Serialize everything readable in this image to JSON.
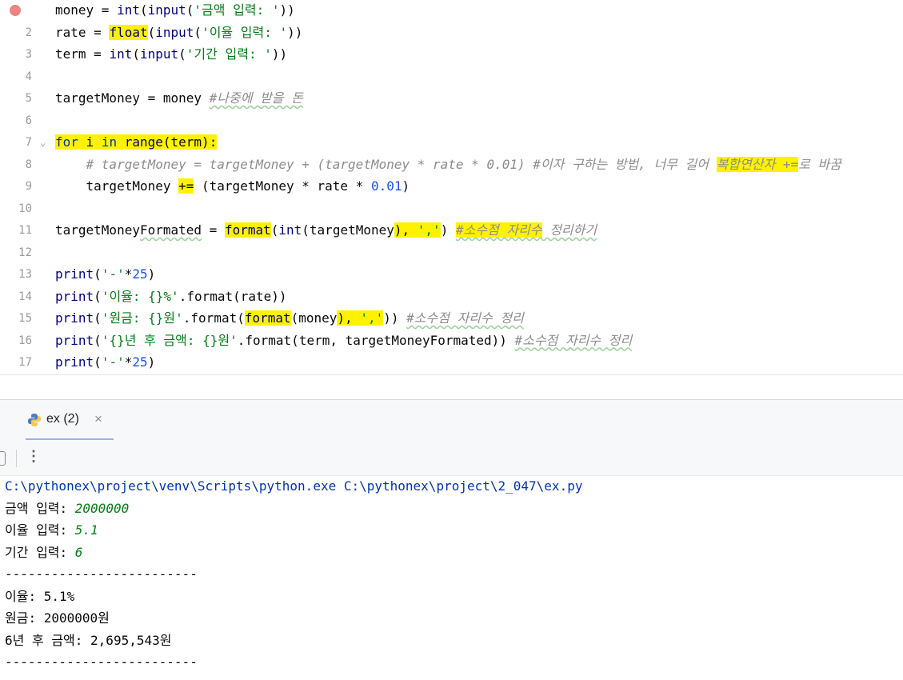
{
  "editor": {
    "lines": [
      {
        "n": "1",
        "tokens": [
          {
            "t": "money = ",
            "c": "plain"
          },
          {
            "t": "int",
            "c": "bi"
          },
          {
            "t": "(",
            "c": "plain"
          },
          {
            "t": "input",
            "c": "bi"
          },
          {
            "t": "(",
            "c": "plain"
          },
          {
            "t": "'금액 입력: '",
            "c": "str"
          },
          {
            "t": "))",
            "c": "plain"
          }
        ]
      },
      {
        "n": "2",
        "tokens": [
          {
            "t": "rate = ",
            "c": "plain"
          },
          {
            "t": "float",
            "c": "bi",
            "h": 1
          },
          {
            "t": "(",
            "c": "plain"
          },
          {
            "t": "input",
            "c": "bi"
          },
          {
            "t": "(",
            "c": "plain"
          },
          {
            "t": "'이율 입력: '",
            "c": "str"
          },
          {
            "t": "))",
            "c": "plain"
          }
        ]
      },
      {
        "n": "3",
        "tokens": [
          {
            "t": "term = ",
            "c": "plain"
          },
          {
            "t": "int",
            "c": "bi"
          },
          {
            "t": "(",
            "c": "plain"
          },
          {
            "t": "input",
            "c": "bi"
          },
          {
            "t": "(",
            "c": "plain"
          },
          {
            "t": "'기간 입력: '",
            "c": "str"
          },
          {
            "t": "))",
            "c": "plain"
          }
        ]
      },
      {
        "n": "4",
        "tokens": []
      },
      {
        "n": "5",
        "tokens": [
          {
            "t": "targetMoney = money ",
            "c": "plain"
          },
          {
            "t": "#나중에 받을 돈",
            "c": "cm-wavy"
          }
        ]
      },
      {
        "n": "6",
        "tokens": []
      },
      {
        "n": "7",
        "tokens": [
          {
            "t": "for",
            "c": "kw",
            "h": 1
          },
          {
            "t": " i ",
            "c": "plain",
            "h": 1
          },
          {
            "t": "in",
            "c": "kw",
            "h": 1
          },
          {
            "t": " ",
            "c": "plain",
            "h": 1
          },
          {
            "t": "range",
            "c": "bi",
            "h": 1
          },
          {
            "t": "(term):",
            "c": "plain",
            "h": 1
          }
        ]
      },
      {
        "n": "8",
        "tokens": [
          {
            "t": "    ",
            "c": "plain"
          },
          {
            "t": "# targetMoney = targetMoney + (targetMoney * rate * 0.01) #이자 구하는 방법, 너무 길어 ",
            "c": "cm"
          },
          {
            "t": "복합연산자 +=",
            "c": "cm",
            "h": 1
          },
          {
            "t": "로 바꿈",
            "c": "cm"
          }
        ]
      },
      {
        "n": "9",
        "tokens": [
          {
            "t": "    targetMoney ",
            "c": "plain"
          },
          {
            "t": "+=",
            "c": "plain",
            "h": 1
          },
          {
            "t": " (targetMoney * rate * ",
            "c": "plain"
          },
          {
            "t": "0.01",
            "c": "num"
          },
          {
            "t": ")",
            "c": "plain"
          }
        ]
      },
      {
        "n": "10",
        "tokens": []
      },
      {
        "n": "11",
        "tokens": [
          {
            "t": "targetMoney",
            "c": "plain"
          },
          {
            "t": "Formated",
            "c": "plain",
            "w": 1
          },
          {
            "t": " = ",
            "c": "plain"
          },
          {
            "t": "format",
            "c": "bi",
            "h": 1
          },
          {
            "t": "(",
            "c": "plain"
          },
          {
            "t": "int",
            "c": "bi"
          },
          {
            "t": "(targetMoney",
            "c": "plain"
          },
          {
            "t": "), ",
            "c": "plain",
            "h": 1
          },
          {
            "t": "','",
            "c": "str",
            "h": 1
          },
          {
            "t": ")",
            "c": "plain"
          },
          {
            "t": " ",
            "c": "plain"
          },
          {
            "t": "#소수점 자리수",
            "c": "cm-wavy",
            "h": 1
          },
          {
            "t": " 정리하기",
            "c": "cm-wavy"
          }
        ]
      },
      {
        "n": "12",
        "tokens": []
      },
      {
        "n": "13",
        "tokens": [
          {
            "t": "print",
            "c": "bi"
          },
          {
            "t": "(",
            "c": "plain"
          },
          {
            "t": "'-'",
            "c": "str"
          },
          {
            "t": "*",
            "c": "plain"
          },
          {
            "t": "25",
            "c": "num"
          },
          {
            "t": ")",
            "c": "plain"
          }
        ]
      },
      {
        "n": "14",
        "tokens": [
          {
            "t": "print",
            "c": "bi"
          },
          {
            "t": "(",
            "c": "plain"
          },
          {
            "t": "'이율: {}%'",
            "c": "str"
          },
          {
            "t": ".format(rate))",
            "c": "plain"
          }
        ]
      },
      {
        "n": "15",
        "tokens": [
          {
            "t": "print",
            "c": "bi"
          },
          {
            "t": "(",
            "c": "plain"
          },
          {
            "t": "'원금: {}원'",
            "c": "str"
          },
          {
            "t": ".format(",
            "c": "plain"
          },
          {
            "t": "format",
            "c": "bi",
            "h": 1
          },
          {
            "t": "(money",
            "c": "plain"
          },
          {
            "t": "), ",
            "c": "plain",
            "h": 1
          },
          {
            "t": "','",
            "c": "str",
            "h": 1
          },
          {
            "t": "))",
            "c": "plain"
          },
          {
            "t": " ",
            "c": "plain"
          },
          {
            "t": "#소수점 자리수 정리",
            "c": "cm-wavy"
          }
        ]
      },
      {
        "n": "16",
        "tokens": [
          {
            "t": "print",
            "c": "bi"
          },
          {
            "t": "(",
            "c": "plain"
          },
          {
            "t": "'{}년 후 금액: {}원'",
            "c": "str"
          },
          {
            "t": ".format(term, targetMoneyFormated))",
            "c": "plain"
          },
          {
            "t": " ",
            "c": "plain"
          },
          {
            "t": "#소수점 자리수 정리",
            "c": "cm-wavy"
          }
        ]
      },
      {
        "n": "17",
        "tokens": [
          {
            "t": "print",
            "c": "bi"
          },
          {
            "t": "(",
            "c": "plain"
          },
          {
            "t": "'-'",
            "c": "str"
          },
          {
            "t": "*",
            "c": "plain"
          },
          {
            "t": "25",
            "c": "num"
          },
          {
            "t": ")",
            "c": "plain"
          }
        ]
      }
    ]
  },
  "run_panel": {
    "tab_label": "ex (2)",
    "close_glyph": "×",
    "more_glyph": "⋮"
  },
  "console": {
    "lines": [
      {
        "tokens": [
          {
            "t": "C:\\pythonex\\project\\venv\\Scripts\\python.exe C:\\pythonex\\project\\2_047\\ex.py",
            "c": "con-cmd"
          }
        ]
      },
      {
        "tokens": [
          {
            "t": "금액 입력: ",
            "c": "plain"
          },
          {
            "t": "2000000",
            "c": "con-in"
          }
        ]
      },
      {
        "tokens": [
          {
            "t": "이율 입력: ",
            "c": "plain"
          },
          {
            "t": "5.1",
            "c": "con-in"
          }
        ]
      },
      {
        "tokens": [
          {
            "t": "기간 입력: ",
            "c": "plain"
          },
          {
            "t": "6",
            "c": "con-in"
          }
        ]
      },
      {
        "tokens": [
          {
            "t": "-------------------------",
            "c": "plain"
          }
        ]
      },
      {
        "tokens": [
          {
            "t": "이율: 5.1%",
            "c": "plain"
          }
        ]
      },
      {
        "tokens": [
          {
            "t": "원금: 2000000원",
            "c": "plain"
          }
        ]
      },
      {
        "tokens": [
          {
            "t": "6년 후 금액: 2,695,543원",
            "c": "plain"
          }
        ]
      },
      {
        "tokens": [
          {
            "t": "-------------------------",
            "c": "plain"
          }
        ]
      }
    ]
  },
  "colors": {
    "highlight": "#fff200",
    "keyword": "#0033b3",
    "string": "#067d17",
    "number": "#1750eb",
    "comment": "#8c8c8c"
  }
}
